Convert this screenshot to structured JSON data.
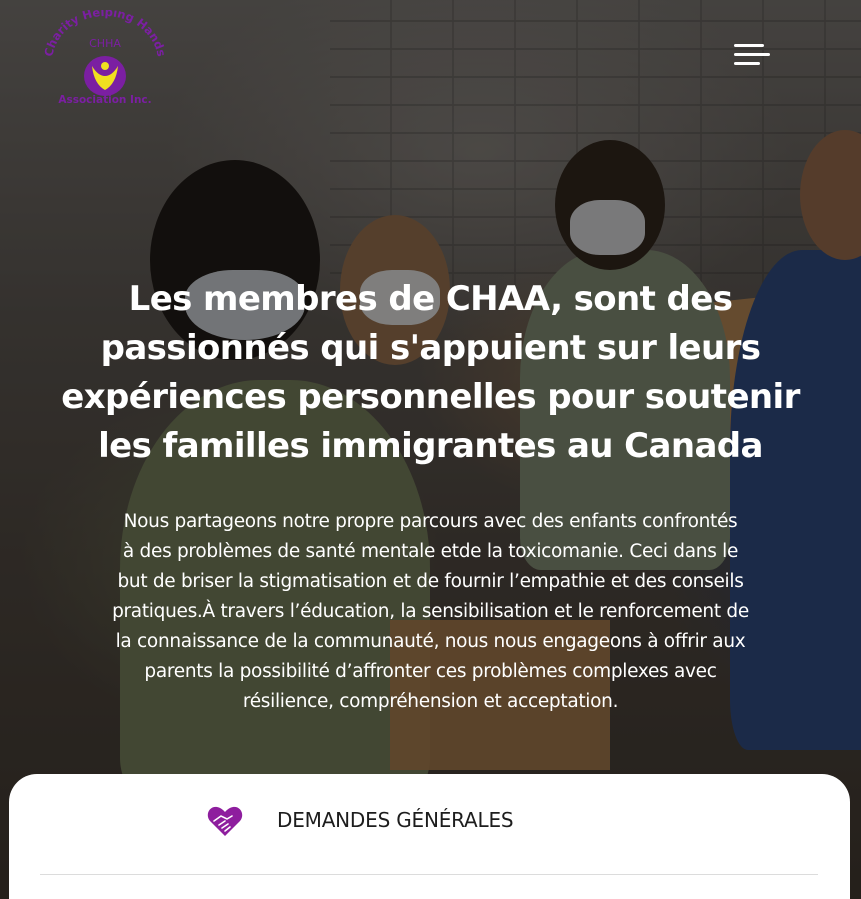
{
  "logo": {
    "arc_text": "Charity Helping Hands",
    "acronym": "CHHA",
    "bottom_text": "Association Inc.",
    "color": "#7b1fa2"
  },
  "nav": {
    "menu_icon": "hamburger-menu-icon"
  },
  "hero": {
    "headline_lines": [
      "Les membres de CHAA, sont des",
      "passionnés qui s'appuient sur leurs",
      "expériences personnelles pour soutenir",
      "les familles immigrantes au Canada"
    ],
    "intro_lines": [
      "Nous partageons notre propre parcours avec des enfants confrontés",
      "à des problèmes de santé mentale etde la toxicomanie. Ceci dans le",
      "but de briser la stigmatisation et de fournir l’empathie et des conseils",
      "pratiques.À travers l’éducation, la sensibilisation et le renforcement de",
      "la connaissance de la communauté, nous nous engageons à offrir aux",
      "parents la possibilité d’affronter ces problèmes complexes avec",
      "résilience, compréhension et acceptation."
    ]
  },
  "card": {
    "icon": "heart-handshake-icon",
    "title": "DEMANDES GÉNÉRALES",
    "icon_color": "#8e1e9e"
  }
}
